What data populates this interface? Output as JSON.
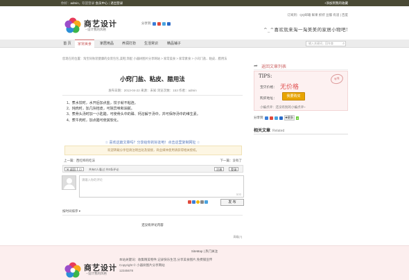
{
  "topbar": {
    "greeting": "你好：",
    "user": "admin",
    "welcome": "，欢迎登录",
    "member": "会员中心",
    "logout": "退出登录",
    "fav": "+添加到我的收藏"
  },
  "site": {
    "name": "商艺设计",
    "tagline": "--设计我的风格"
  },
  "header": {
    "share_label": "分享到",
    "top_links": "订阅到：QQ邮箱 鲜果 抓虾 豆瓣 有道 | 百度",
    "slogan": "^_^喜欢就来淘一淘美美的家居小物吧!",
    "colors": {
      "qq": "#3b7dd8",
      "sina": "#e04a3c",
      "wb": "#4aa3df",
      "douban": "#2f9e49",
      "renren": "#2b6ac6"
    }
  },
  "nav": {
    "items": [
      "首 页",
      "家常美食",
      "家居用品",
      "养润打扮",
      "生活常识",
      "精品铺子"
    ],
    "active_index": 1,
    "search_placeholder": "输入关键词，回车查"
  },
  "breadcrumb": "您现在的位置：淘宝同秋装健康的女装包包,美鞋,饰配 小器树图片分享网站 > 家常美食 > 家常素食 > 小窍门盐、粘皮、腊用法",
  "article": {
    "title": "小窍门盐、粘皮、腊用法",
    "date_label": "发布日期：",
    "date": "2013-04-22",
    "source_label": "来源：",
    "source": "未知",
    "views_label": "浏览次数：",
    "views": "153",
    "author_label": "作者：",
    "author": "admin",
    "paragraphs": [
      "1、煮水饺时，水开后加点盐，饺子就不粘连。",
      "2、炖肉时，加几块桔皮，可除异味和油腻。",
      "3、煮骨头汤时加一小匙醋，可使骨头中的磷、钙溶解于汤中，并可保存汤中的维生素。",
      "4、煮牛肉时，加点醋可使其软化。"
    ],
    "share_note": "☆ 喜欢这篇文章吗？分享给你的好友吧！点击这里复制网址 ☆",
    "notice": "欢迎转载分享但请注明出处及链接，商业媒体使用请获得相关授权。",
    "prev": "上一篇：西红柿的吃法",
    "next": "下一篇：没有了"
  },
  "comments": {
    "bar_btn": "返回",
    "bar_count": "共有0人看过 共0条评论",
    "login_btn": "登录",
    "register_btn": "注册",
    "placeholder": "请输入你的评论",
    "counter": "500",
    "post_btn": "发 布",
    "order": "按时间排序 ▾",
    "empty": "还没有评论内容",
    "powered": "高级[?]"
  },
  "sidebar": {
    "back": "返回文章列表",
    "tips_title": "TIPS:",
    "price_label": "宝贝价格：",
    "price": "无价格",
    "buy_label": "购买地址：",
    "buy_btn": "我要购买",
    "note": "小编点评：还没有别的小编点评~",
    "tag": "手写",
    "share_label": "分享到",
    "share_count": "4",
    "related_title": "相关文章",
    "related_en": "Related"
  },
  "footer": {
    "links": "SiteMap | 热门关注",
    "info": [
      "本站关键词：收集精美物件,记录快乐生活,分享美食图片,免费铺宣传",
      "Copyright © 小器树图片分享网站",
      "12345678"
    ]
  }
}
